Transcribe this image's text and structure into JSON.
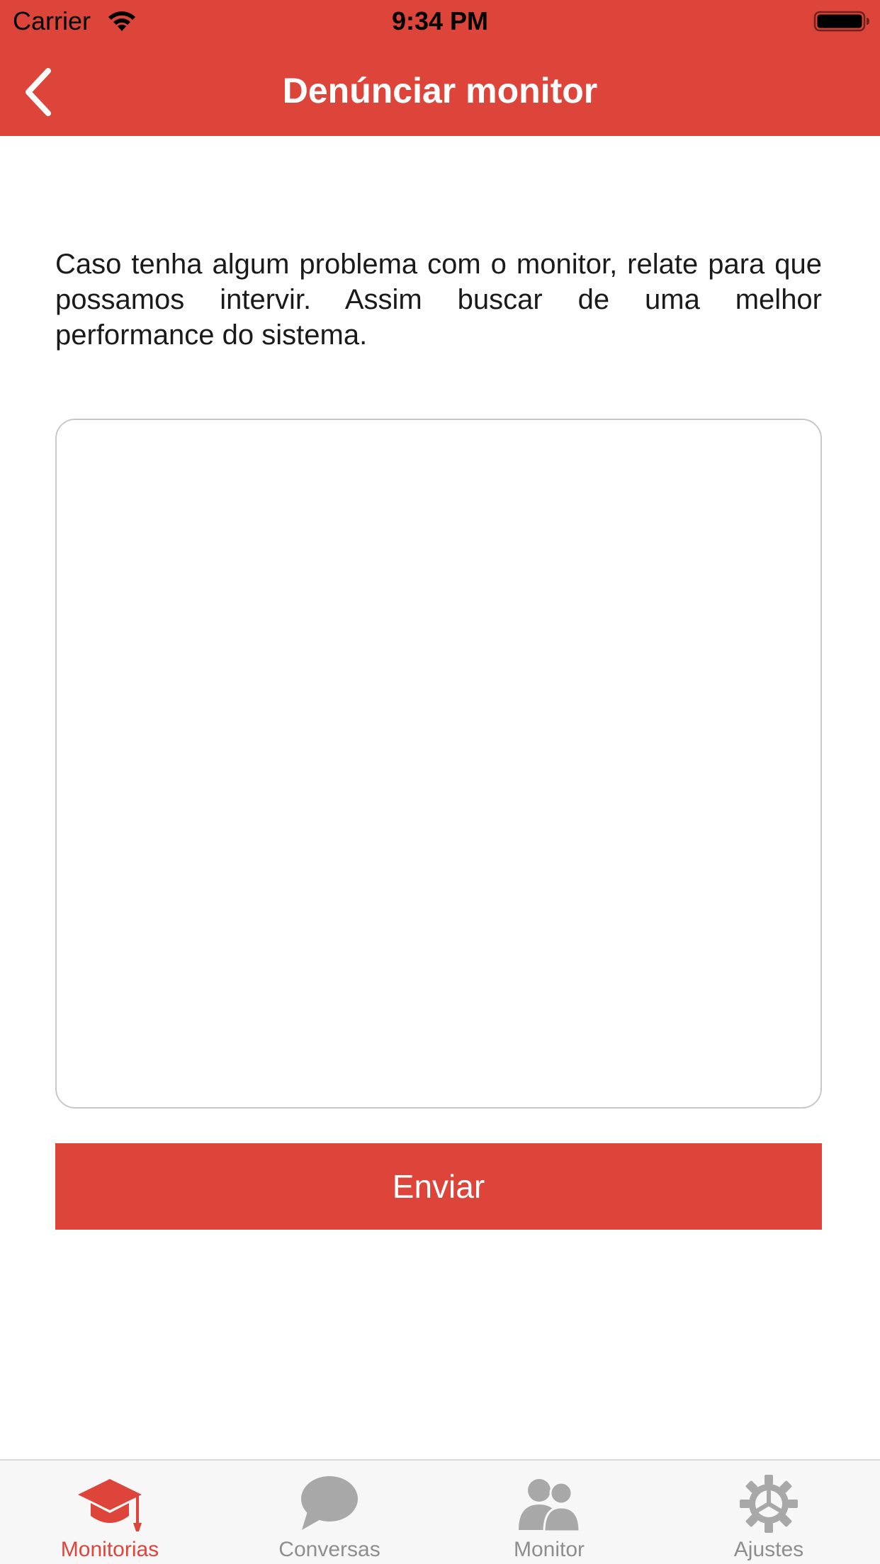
{
  "status_bar": {
    "carrier": "Carrier",
    "time": "9:34 PM"
  },
  "nav": {
    "title": "Denúnciar monitor"
  },
  "main": {
    "description": "Caso tenha algum problema com o monitor, relate para que possamos intervir. Assim buscar de uma melhor performance do sistema.",
    "textarea_value": "",
    "send_label": "Enviar"
  },
  "tab_bar": {
    "tabs": [
      {
        "label": "Monitorias",
        "icon": "graduation-cap-icon",
        "active": true
      },
      {
        "label": "Conversas",
        "icon": "chat-bubble-icon",
        "active": false
      },
      {
        "label": "Monitor",
        "icon": "users-icon",
        "active": false
      },
      {
        "label": "Ajustes",
        "icon": "gear-icon",
        "active": false
      }
    ]
  },
  "colors": {
    "accent": "#de453a",
    "tab_inactive": "#8e8e8e",
    "tab_bar_bg": "#f7f7f7"
  }
}
